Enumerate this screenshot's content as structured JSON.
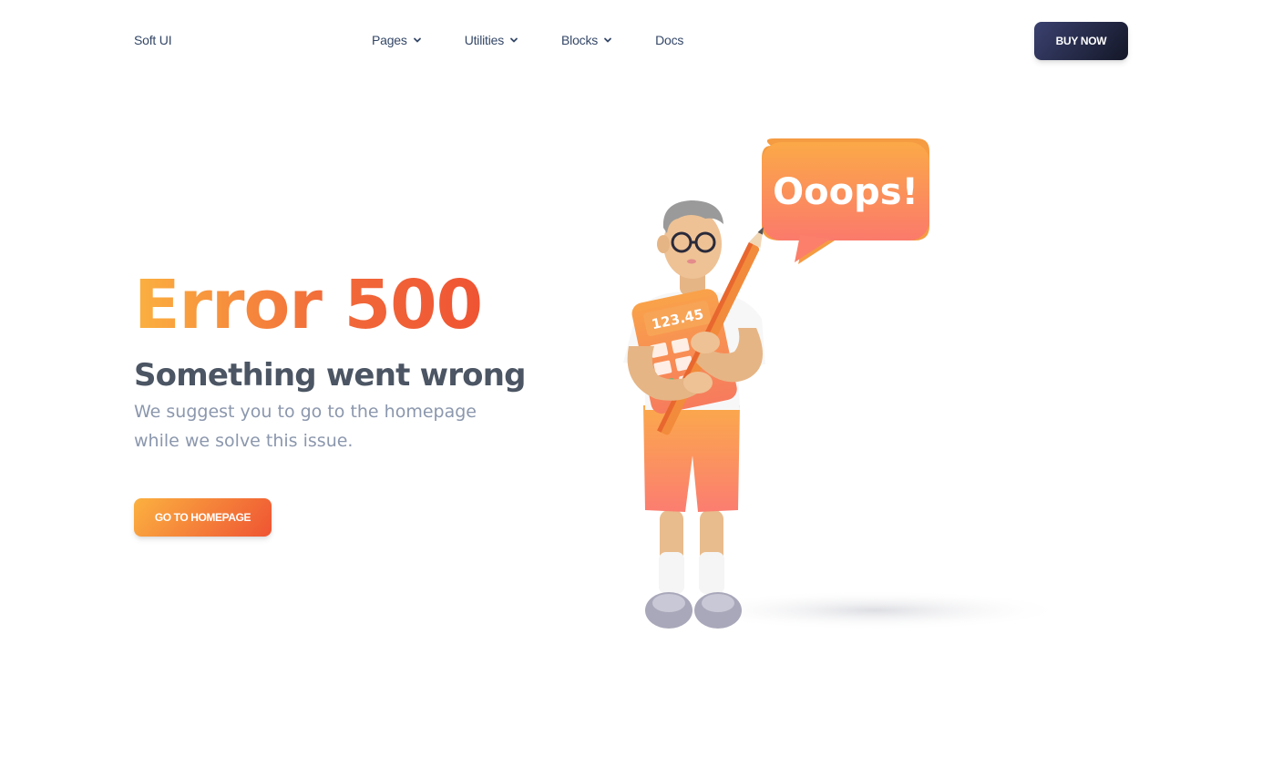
{
  "navbar": {
    "brand": "Soft UI",
    "items": [
      {
        "label": "Pages",
        "has_dropdown": true
      },
      {
        "label": "Utilities",
        "has_dropdown": true
      },
      {
        "label": "Blocks",
        "has_dropdown": true
      },
      {
        "label": "Docs",
        "has_dropdown": false
      }
    ],
    "cta_label": "BUY NOW"
  },
  "hero": {
    "title": "Error 500",
    "subtitle": "Something went wrong",
    "description": "We suggest you to go to the homepage while we solve this issue.",
    "button_label": "GO TO HOMEPAGE"
  },
  "illustration": {
    "bubble_text": "Ooops!",
    "calculator_display": "123.45",
    "icon": "person-with-calculator-and-pencil-illustration"
  },
  "colors": {
    "primary_dark": "#344767",
    "gradient_orange_start": "#fbb140",
    "gradient_orange_end": "#ef5433",
    "dark_button": "#141727",
    "muted_text": "#8b97ad"
  }
}
